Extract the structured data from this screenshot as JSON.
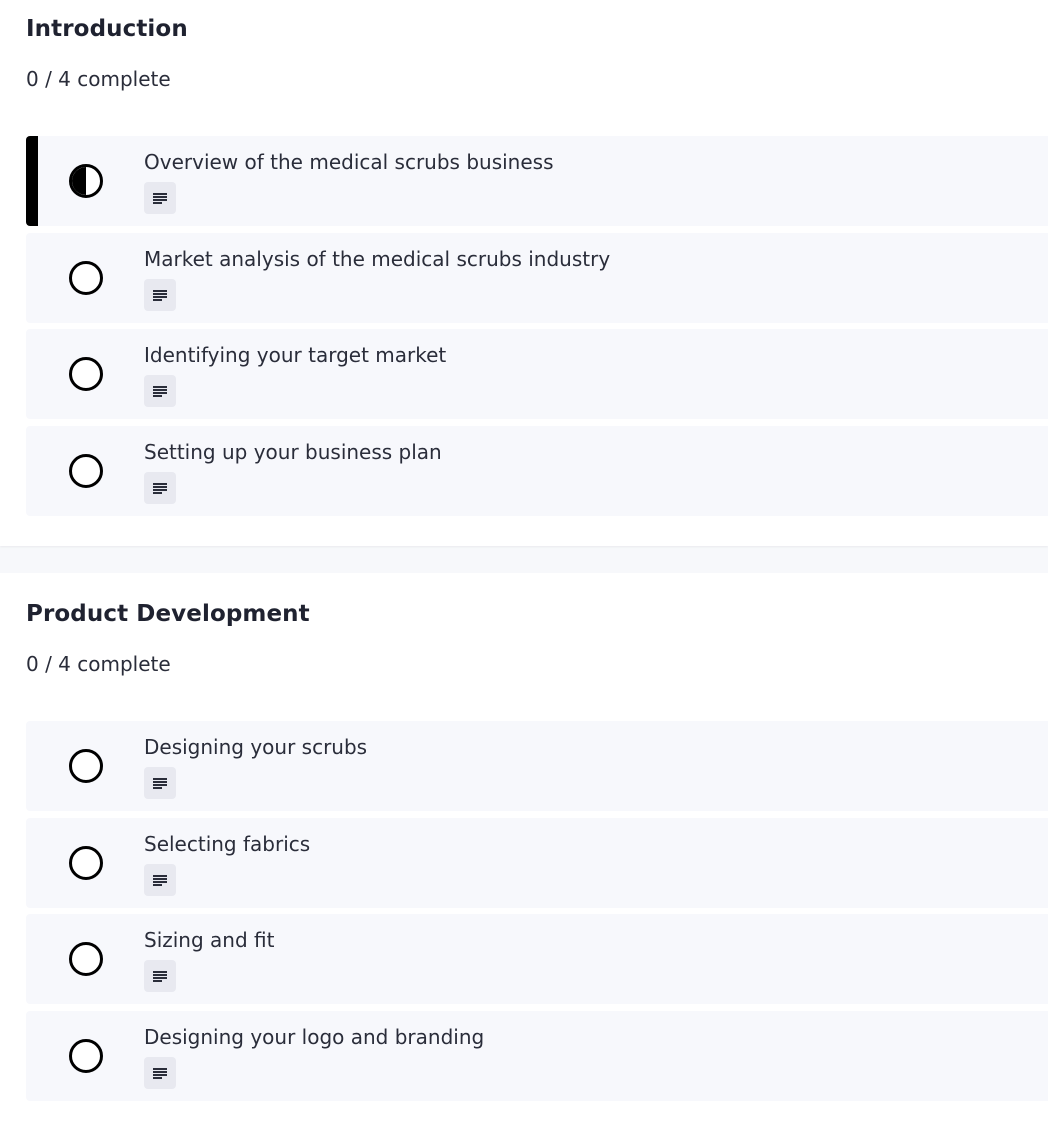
{
  "sections": [
    {
      "title": "Introduction",
      "progress": "0 / 4 complete",
      "lessons": [
        {
          "title": "Overview of the medical scrubs business",
          "status": "in-progress",
          "icon": "text-document-icon"
        },
        {
          "title": "Market analysis of the medical scrubs industry",
          "status": "not-started",
          "icon": "text-document-icon"
        },
        {
          "title": "Identifying your target market",
          "status": "not-started",
          "icon": "text-document-icon"
        },
        {
          "title": "Setting up your business plan",
          "status": "not-started",
          "icon": "text-document-icon"
        }
      ]
    },
    {
      "title": "Product Development",
      "progress": "0 / 4 complete",
      "lessons": [
        {
          "title": "Designing your scrubs",
          "status": "not-started",
          "icon": "text-document-icon"
        },
        {
          "title": "Selecting fabrics",
          "status": "not-started",
          "icon": "text-document-icon"
        },
        {
          "title": "Sizing and fit",
          "status": "not-started",
          "icon": "text-document-icon"
        },
        {
          "title": "Designing your logo and branding",
          "status": "not-started",
          "icon": "text-document-icon"
        }
      ]
    }
  ],
  "colors": {
    "accent": "#000000",
    "card_background": "#f7f8fc",
    "icon_background": "#e8e9f0"
  }
}
